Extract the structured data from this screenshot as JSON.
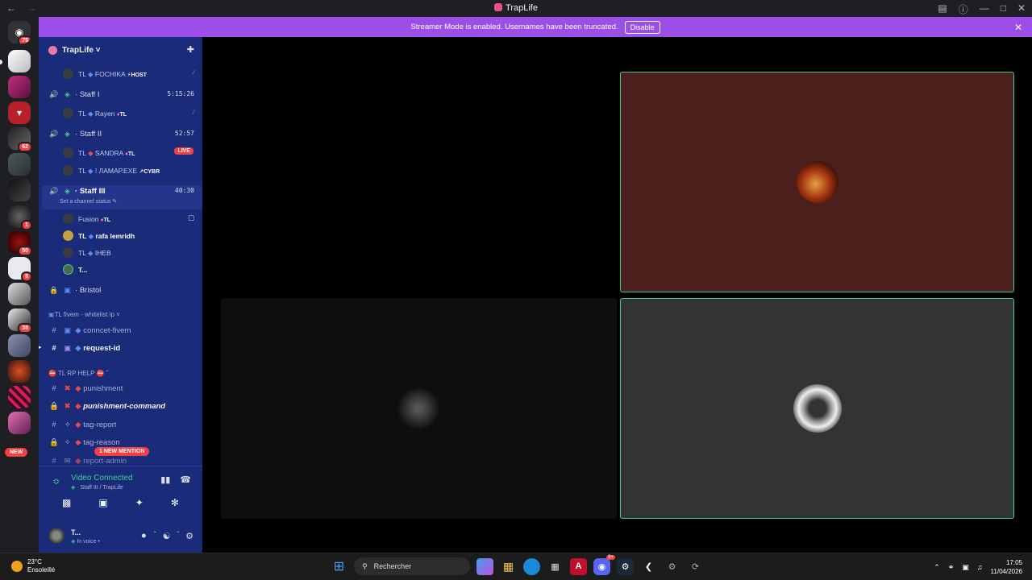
{
  "window": {
    "title": "TrapLife",
    "back_icon": "arrow-left",
    "forward_icon": "arrow-right"
  },
  "banner": {
    "text": "Streamer Mode is enabled. Usernames have been truncated.",
    "button": "Disable"
  },
  "rail": {
    "home_badge": "75",
    "badges": [
      "62",
      "1",
      "50",
      "8",
      "38"
    ],
    "new_label": "NEW"
  },
  "server": {
    "name": "TrapLife ˅"
  },
  "channels": {
    "host_member": {
      "prefix": "TL",
      "name": "FOCHIKA",
      "tag": "HOST"
    },
    "staff1": {
      "name": "· Staff I",
      "timer": "5:15:26",
      "member": {
        "prefix": "TL",
        "name": "Rayen",
        "tag": "TL"
      }
    },
    "staff2": {
      "name": "· Staff II",
      "timer": "52:57",
      "members": [
        {
          "prefix": "TL",
          "name": "SANDRA",
          "tag": "TL",
          "live": "LIVE"
        },
        {
          "prefix": "TL",
          "name": "! ЛАМАР.EXE",
          "tag": "CYBR"
        }
      ]
    },
    "staff3": {
      "name": "· Staff III",
      "timer": "40:30",
      "status": "Set a channel status",
      "members": [
        {
          "name": "Fusion",
          "tag": "TL"
        },
        {
          "prefix": "TL",
          "name": "rafa lemridh"
        },
        {
          "prefix": "TL",
          "name": "IHEB"
        },
        {
          "name": "T..."
        }
      ]
    },
    "bristol": "· Bristol",
    "cat_fivem": "TL fivem - whitelist ip ˅",
    "connect_fivem": "conncet-fivem",
    "request_id": "request-id",
    "cat_help": "TL RP HELP",
    "punishment": "punishment",
    "punishment_command": "punishment-command",
    "tag_report": "tag-report",
    "tag_reason": "tag-reason",
    "report_admin": "report-admin",
    "mention": "1 NEW MENTION"
  },
  "voice_panel": {
    "status": "Video Connected",
    "channel": "· Staff III / TrapLife",
    "user_name": "T...",
    "user_status": "In voice •"
  },
  "taskbar": {
    "temp": "23°C",
    "weather": "Ensoleillé",
    "search": "Rechercher",
    "discord_badge": "9+",
    "time": "17:05",
    "date": "11/04/2026"
  },
  "colors": {
    "sidebar": "#1a2b7a",
    "banner": "#9b4fe8",
    "speaking_border": "#3ecf8e",
    "tile_red": "#4a1f1c",
    "tile_grey": "#333333",
    "tile_dark": "#0e0e0e"
  }
}
